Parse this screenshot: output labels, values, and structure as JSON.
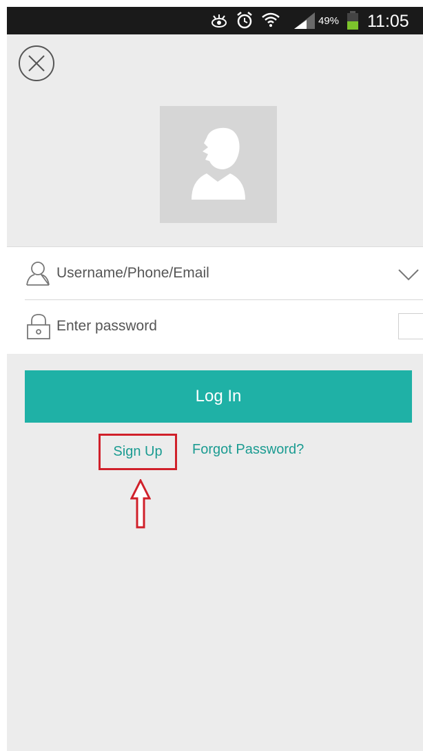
{
  "status_bar": {
    "battery_percent": "49%",
    "time": "11:05",
    "battery_color": "#7cc42c",
    "icons": [
      "eye-icon",
      "alarm-clock-icon",
      "wifi-icon",
      "signal-icon",
      "battery-icon"
    ]
  },
  "header": {
    "close_icon": "close-circle-icon",
    "avatar_icon": "default-user-silhouette"
  },
  "form": {
    "username_placeholder": "Username/Phone/Email",
    "password_placeholder": "Enter password",
    "username_icon": "user-icon",
    "password_icon": "lock-icon",
    "dropdown_icon": "chevron-down-icon"
  },
  "actions": {
    "login_label": "Log In",
    "signup_label": "Sign Up",
    "forgot_label": "Forgot Password?"
  },
  "colors": {
    "accent": "#1fb1a6",
    "link": "#1a9b91",
    "annotation": "#d0202a",
    "background": "#ececec"
  }
}
